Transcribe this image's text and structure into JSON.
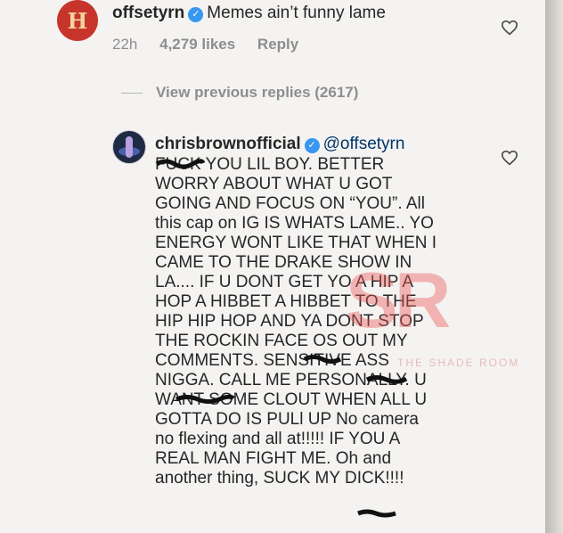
{
  "comment1": {
    "username": "offsetyrn",
    "text": "Memes ain’t funny lame",
    "time": "22h",
    "likes": "4,279 likes",
    "reply_label": "Reply",
    "avatar_letter": "H"
  },
  "view_replies": "View previous replies (2617)",
  "comment2": {
    "username": "chrisbrownofficial",
    "mention": "@offsetyrn",
    "lines": [
      "FUCK YOU LIL BOY. BETTER",
      "WORRY ABOUT WHAT U GOT",
      "GOING AND FOCUS ON “YOU”. All",
      "this cap on IG IS WHATS LAME.. YO",
      "ENERGY WONT LIKE THAT WHEN I",
      "CAME TO THE DRAKE SHOW IN",
      "LA.... IF U DONT  GET YO A HIP A",
      "HOP A HIBBET A HIBBET TO THE",
      "HIP HIP HOP AND YA DONT STOP",
      "THE ROCKIN  FACE OS OUT MY",
      "COMMENTS. SENSITIVE ASS",
      "NIGGA. CALL ME PERSONALLY. U",
      "WANT SOME CLOUT WHEN ALL U",
      "GOTTA DO IS PULl UP No camera",
      "no flexing and all at!!!!! IF YOU A",
      "REAL MAN FIGHT ME. Oh and",
      "another thing,  SUCK MY DICK!!!!"
    ]
  },
  "watermark": {
    "letters": "SR",
    "tag": "THE SHADE ROOM"
  },
  "colors": {
    "verified": "#3897f0",
    "text": "#262626",
    "meta": "#8e8e8e",
    "mention": "#003569"
  },
  "icons": [
    "verified-badge-icon",
    "heart-icon"
  ]
}
